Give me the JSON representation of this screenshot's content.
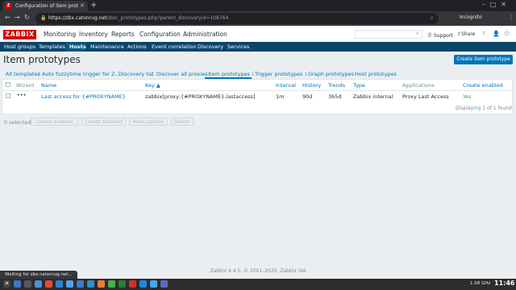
{
  "browser": {
    "tab_title": "Configuration of item prot",
    "url_host": "https://zbx.catonrug.net",
    "url_path": "/disc_prototypes.php?parent_discoveryid=108764",
    "incognito": "Incognito",
    "status_text": "Waiting for zbx.catonrug.net..."
  },
  "header": {
    "logo": "ZABBIX",
    "menu": [
      "Monitoring",
      "Inventory",
      "Reports",
      "Configuration",
      "Administration"
    ],
    "support": "Support",
    "share": "Share"
  },
  "subnav": [
    "Host groups",
    "Templates",
    "Hosts",
    "Maintenance",
    "Actions",
    "Event correlation",
    "Discovery",
    "Services"
  ],
  "page": {
    "title": "Item prototypes",
    "create_button": "Create item prototype"
  },
  "breadcrumbs": {
    "all_templates": "All templates",
    "template": "Auto fuzzytime trigger for Z...",
    "discovery_list": "Discovery list",
    "discovery_rule": "Discover all proxies",
    "tabs": [
      {
        "label": "Item prototypes",
        "count": "1"
      },
      {
        "label": "Trigger prototypes",
        "count": "1"
      },
      {
        "label": "Graph prototypes",
        "count": ""
      },
      {
        "label": "Host prototypes",
        "count": ""
      }
    ]
  },
  "table": {
    "columns": [
      "Wizard",
      "Name",
      "Key ▲",
      "Interval",
      "History",
      "Trends",
      "Type",
      "Applications",
      "Create enabled"
    ],
    "rows": [
      {
        "wizard": "•••",
        "name": "Last access for {#PROXYNAME}",
        "key": "zabbix[proxy,{#PROXYNAME},lastaccess]",
        "interval": "1m",
        "history": "90d",
        "trends": "365d",
        "type": "Zabbix internal",
        "applications": "Proxy Last Access",
        "create_enabled": "Yes"
      }
    ],
    "displaying": "Displaying 1 of 1 found"
  },
  "actions": {
    "selected": "0 selected",
    "buttons": [
      "Create enabled",
      "Create disabled",
      "Mass update",
      "Delete"
    ]
  },
  "footer": "Zabbix 4.4.5. © 2001–2020, Zabbix SIA",
  "taskbar": {
    "cpu": "1.58 GHz",
    "clock": "11:46"
  },
  "colors": {
    "accent": "#0275b8",
    "brand": "#d40000",
    "subnav_bg": "#0a466a",
    "enabled_green": "#429e47"
  }
}
